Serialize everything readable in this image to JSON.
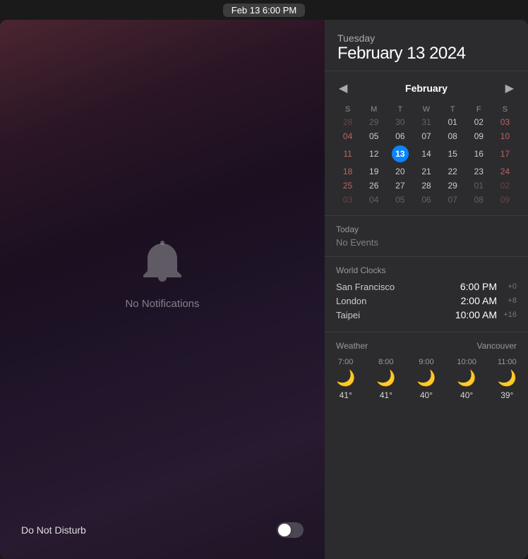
{
  "menubar": {
    "datetime": "Feb 13   6:00 PM"
  },
  "left_panel": {
    "notification_icon": "bell",
    "no_notifications_label": "No Notifications",
    "dnd_label": "Do Not Disturb",
    "dnd_enabled": false
  },
  "calendar": {
    "weekday": "Tuesday",
    "date_full": "February 13 2024",
    "month_label": "February",
    "prev_icon": "◀",
    "next_icon": "▶",
    "day_headers": [
      "S",
      "M",
      "T",
      "W",
      "T",
      "F",
      "S"
    ],
    "weeks": [
      [
        {
          "day": "28",
          "other": true
        },
        {
          "day": "29",
          "other": true
        },
        {
          "day": "30",
          "other": true
        },
        {
          "day": "31",
          "other": true
        },
        {
          "day": "01",
          "weekend": false,
          "highlight": true
        },
        {
          "day": "02",
          "other": false
        },
        {
          "day": "03",
          "weekend": true
        }
      ],
      [
        {
          "day": "04",
          "weekend": true
        },
        {
          "day": "05"
        },
        {
          "day": "06"
        },
        {
          "day": "07"
        },
        {
          "day": "08"
        },
        {
          "day": "09"
        },
        {
          "day": "10",
          "weekend": true
        }
      ],
      [
        {
          "day": "11",
          "weekend": true
        },
        {
          "day": "12"
        },
        {
          "day": "13",
          "today": true
        },
        {
          "day": "14"
        },
        {
          "day": "15"
        },
        {
          "day": "16"
        },
        {
          "day": "17",
          "weekend": true
        }
      ],
      [
        {
          "day": "18",
          "weekend": true
        },
        {
          "day": "19"
        },
        {
          "day": "20"
        },
        {
          "day": "21"
        },
        {
          "day": "22"
        },
        {
          "day": "23"
        },
        {
          "day": "24",
          "weekend": true
        }
      ],
      [
        {
          "day": "25",
          "weekend": true
        },
        {
          "day": "26"
        },
        {
          "day": "27"
        },
        {
          "day": "28"
        },
        {
          "day": "29"
        },
        {
          "day": "01",
          "other": true
        },
        {
          "day": "02",
          "other": true,
          "weekend": true
        }
      ],
      [
        {
          "day": "03",
          "other": true,
          "weekend": true
        },
        {
          "day": "04",
          "other": true
        },
        {
          "day": "05",
          "other": true
        },
        {
          "day": "06",
          "other": true
        },
        {
          "day": "07",
          "other": true
        },
        {
          "day": "08",
          "other": true
        },
        {
          "day": "09",
          "other": true,
          "weekend": true
        }
      ]
    ]
  },
  "events": {
    "title": "Today",
    "no_events": "No Events"
  },
  "world_clocks": {
    "title": "World Clocks",
    "clocks": [
      {
        "city": "San Francisco",
        "time": "6:00 PM",
        "offset": "+0"
      },
      {
        "city": "London",
        "time": "2:00 AM",
        "offset": "+8"
      },
      {
        "city": "Taipei",
        "time": "10:00 AM",
        "offset": "+16"
      }
    ]
  },
  "weather": {
    "title": "Weather",
    "location": "Vancouver",
    "hours": [
      {
        "time": "7:00",
        "icon": "🌙",
        "temp": "41°"
      },
      {
        "time": "8:00",
        "icon": "🌙",
        "temp": "41°"
      },
      {
        "time": "9:00",
        "icon": "🌙",
        "temp": "40°"
      },
      {
        "time": "10:00",
        "icon": "🌙",
        "temp": "40°"
      },
      {
        "time": "11:00",
        "icon": "🌙",
        "temp": "39°"
      }
    ]
  }
}
